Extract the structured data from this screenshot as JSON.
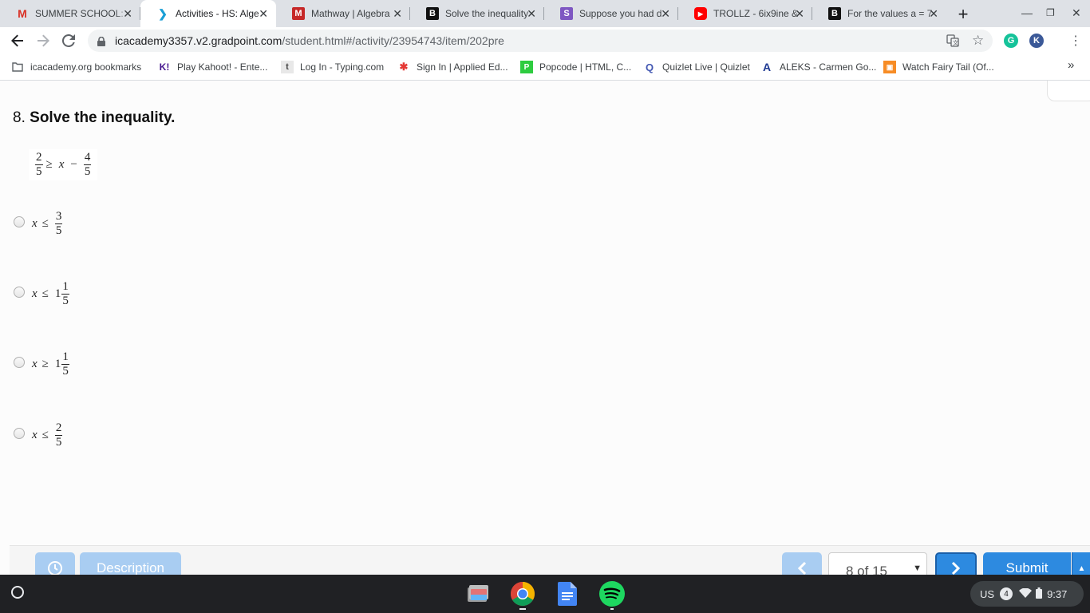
{
  "browser": {
    "tabs": [
      {
        "title": "SUMMER SCHOOL:",
        "icon": "gmail-icon",
        "active": false
      },
      {
        "title": "Activities - HS: Alge",
        "icon": "gradpoint-icon",
        "active": true
      },
      {
        "title": "Mathway | Algebra",
        "icon": "mathway-icon",
        "active": false
      },
      {
        "title": "Solve the inequality",
        "icon": "brainly-icon",
        "active": false
      },
      {
        "title": "Suppose you had d",
        "icon": "socratic-icon",
        "active": false
      },
      {
        "title": "TROLLZ - 6ix9ine &",
        "icon": "youtube-icon",
        "active": false
      },
      {
        "title": "For the values a = 7",
        "icon": "brainly-icon",
        "active": false
      }
    ],
    "new_tab": "+",
    "url_host": "icacademy3357.v2.gradpoint.com",
    "url_path": "/student.html#/activity/23954743/item/202pre",
    "extension_letter": "K",
    "bookmarks": [
      {
        "label": "icacademy.org bookmarks",
        "icon": "folder-icon"
      },
      {
        "label": "Play Kahoot! - Ente...",
        "icon": "kahoot-icon"
      },
      {
        "label": "Log In - Typing.com",
        "icon": "typing-icon"
      },
      {
        "label": "Sign In | Applied Ed...",
        "icon": "applied-ed-icon"
      },
      {
        "label": "Popcode | HTML, C...",
        "icon": "popcode-icon"
      },
      {
        "label": "Quizlet Live | Quizlet",
        "icon": "quizlet-icon"
      },
      {
        "label": "ALEKS - Carmen Go...",
        "icon": "aleks-icon"
      },
      {
        "label": "Watch Fairy Tail (Of...",
        "icon": "crunchyroll-icon"
      }
    ],
    "more_bookmarks": "»"
  },
  "question": {
    "number": "8.",
    "prompt": "Solve the inequality.",
    "inequality": {
      "lhs_num": "2",
      "lhs_den": "5",
      "op": "≥",
      "var": "x",
      "minus": "−",
      "rhs_num": "4",
      "rhs_den": "5"
    },
    "choices": [
      {
        "var": "x",
        "op": "≤",
        "whole": "",
        "num": "3",
        "den": "5"
      },
      {
        "var": "x",
        "op": "≤",
        "whole": "1",
        "num": "1",
        "den": "5"
      },
      {
        "var": "x",
        "op": "≥",
        "whole": "1",
        "num": "1",
        "den": "5"
      },
      {
        "var": "x",
        "op": "≤",
        "whole": "",
        "num": "2",
        "den": "5"
      }
    ]
  },
  "footer": {
    "description_label": "Description",
    "page_indicator": "8 of 15",
    "submit_label": "Submit"
  },
  "taskbar": {
    "apps": [
      "files-icon",
      "chrome-icon",
      "docs-icon",
      "spotify-icon"
    ],
    "locale": "US",
    "notification_count": "4",
    "time": "9:37"
  },
  "colors": {
    "footer_button_blue": "#4f9fe6",
    "footer_button_blue_light": "#a9cdf2",
    "submit_blue": "#2d8ae0",
    "taskbar_bg": "#202124"
  }
}
